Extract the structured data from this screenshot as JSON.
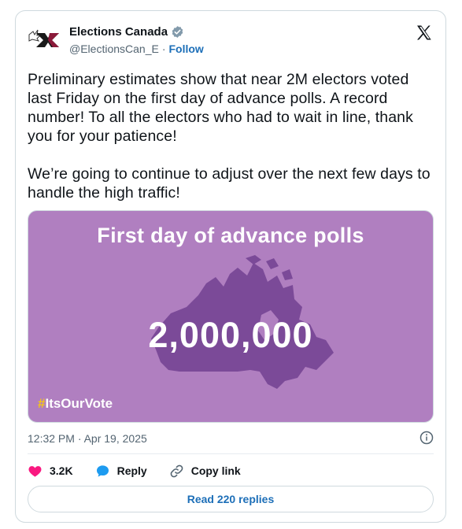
{
  "author": {
    "display_name": "Elections Canada",
    "handle": "@ElectionsCan_E",
    "separator": "·",
    "follow_label": "Follow"
  },
  "tweet": {
    "text": "Preliminary estimates show that near 2M electors voted last Friday on the first day of advance polls. A record number! To all the electors who had to wait in line, thank you for your patience!\n\nWe’re going to continue to adjust over the next few days to handle the high traffic!",
    "timestamp": "12:32 PM · Apr 19, 2025"
  },
  "media": {
    "title": "First day of advance polls",
    "number": "2,000,000",
    "hashtag_symbol": "#",
    "hashtag_text": "ItsOurVote",
    "background_color": "#b07fc0",
    "map_color": "#7b4a98"
  },
  "actions": {
    "like_count": "3.2K",
    "reply_label": "Reply",
    "copy_label": "Copy link"
  },
  "read_replies_label": "Read 220 replies",
  "colors": {
    "like": "#f91880",
    "reply": "#1d9bf0",
    "link": "#1d6fb8",
    "verified": "#829aab"
  }
}
